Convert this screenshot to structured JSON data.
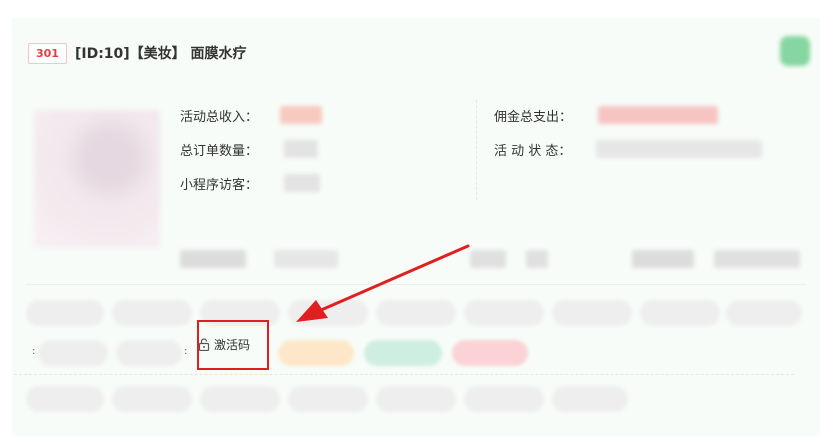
{
  "header": {
    "code": "301",
    "title": "[ID:10]【美妆】 面膜水疗"
  },
  "info": {
    "revenue_label": "活动总收入：",
    "orders_label": "总订单数量：",
    "visitors_label": "小程序访客：",
    "commission_label": "佣金总支出：",
    "status_label": "活 动 状 态："
  },
  "actions": {
    "activation_label": "激活码"
  },
  "colors": {
    "accent_red": "#e02020",
    "code_red": "#e04040",
    "badge_green": "#86d6a1"
  }
}
